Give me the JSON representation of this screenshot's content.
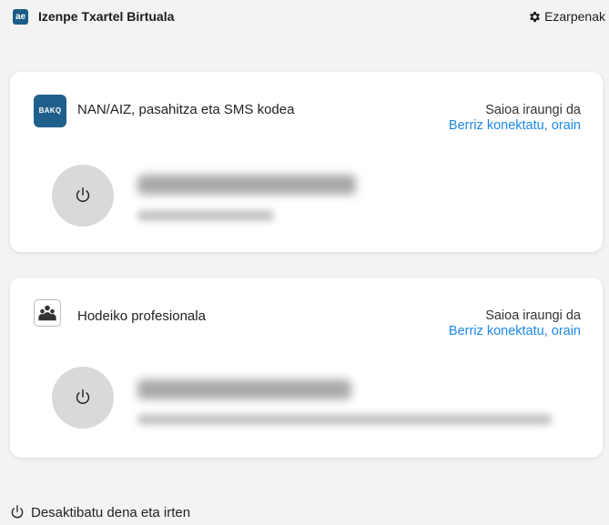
{
  "header": {
    "logo_text": "ae",
    "title": "Izenpe Txartel Birtuala",
    "settings_label": "Ezarpenak"
  },
  "cards": [
    {
      "provider_icon_text": "BAKQ",
      "title": "NAN/AIZ, pasahitza eta SMS kodea",
      "status": "Saioa iraungi da",
      "reconnect_label": "Berriz konektatu, orain"
    },
    {
      "title": "Hodeiko profesionala",
      "status": "Saioa iraungi da",
      "reconnect_label": "Berriz konektatu, orain"
    }
  ],
  "footer": {
    "label": "Desaktibatu dena eta irten"
  },
  "colors": {
    "accent_link": "#1e88e5",
    "brand": "#1f5f8b",
    "background": "#f3f3f3"
  }
}
